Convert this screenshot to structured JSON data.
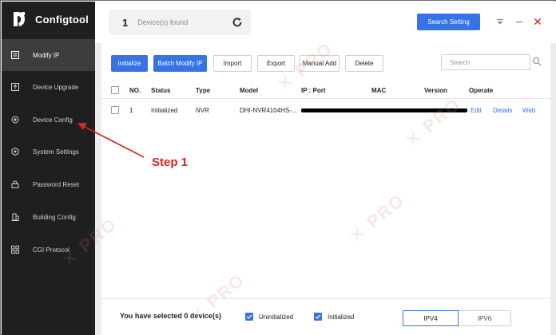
{
  "app": {
    "title": "Configtool"
  },
  "sidebar": {
    "items": [
      {
        "label": "Modify IP",
        "icon": "modify-ip-icon",
        "active": true
      },
      {
        "label": "Device Upgrade",
        "icon": "upgrade-icon",
        "active": false
      },
      {
        "label": "Device Config",
        "icon": "device-config-icon",
        "active": false
      },
      {
        "label": "System Settings",
        "icon": "system-settings-icon",
        "active": false
      },
      {
        "label": "Password Reset",
        "icon": "lock-icon",
        "active": false
      },
      {
        "label": "Building Config",
        "icon": "building-icon",
        "active": false
      },
      {
        "label": "CGI Protocol",
        "icon": "cgi-icon",
        "active": false
      }
    ]
  },
  "topbar": {
    "count": "1",
    "found_label": "Device(s) found",
    "search_setting": "Search Setting"
  },
  "toolbar": {
    "initialize": "Initialize",
    "batch_modify": "Batch Modify IP",
    "import": "Import",
    "export": "Export",
    "manual_add": "Manual Add",
    "delete": "Delete",
    "search_placeholder": "Search"
  },
  "table": {
    "headers": {
      "no": "NO.",
      "status": "Status",
      "type": "Type",
      "model": "Model",
      "ip": "IP : Port",
      "mac": "MAC",
      "version": "Version",
      "operate": "Operate"
    },
    "rows": [
      {
        "no": "1",
        "status": "Initialized",
        "type": "NVR",
        "model": "DHI-NVR4104HS-...",
        "edit": "Edit",
        "details": "Details",
        "web": "Web"
      }
    ]
  },
  "footer": {
    "selected_prefix": "You have selected",
    "selected_count": "0",
    "selected_suffix": "device(s)",
    "uninitialized": "Uninitialized",
    "initialized": "Initialized",
    "ipv4": "IPV4",
    "ipv6": "IPV6"
  },
  "annotation": {
    "step": "Step 1",
    "color": "#e02020"
  },
  "colors": {
    "accent": "#3573e6",
    "sidebar_bg": "#1f1f1f",
    "sidebar_active": "#3d3d3d"
  }
}
